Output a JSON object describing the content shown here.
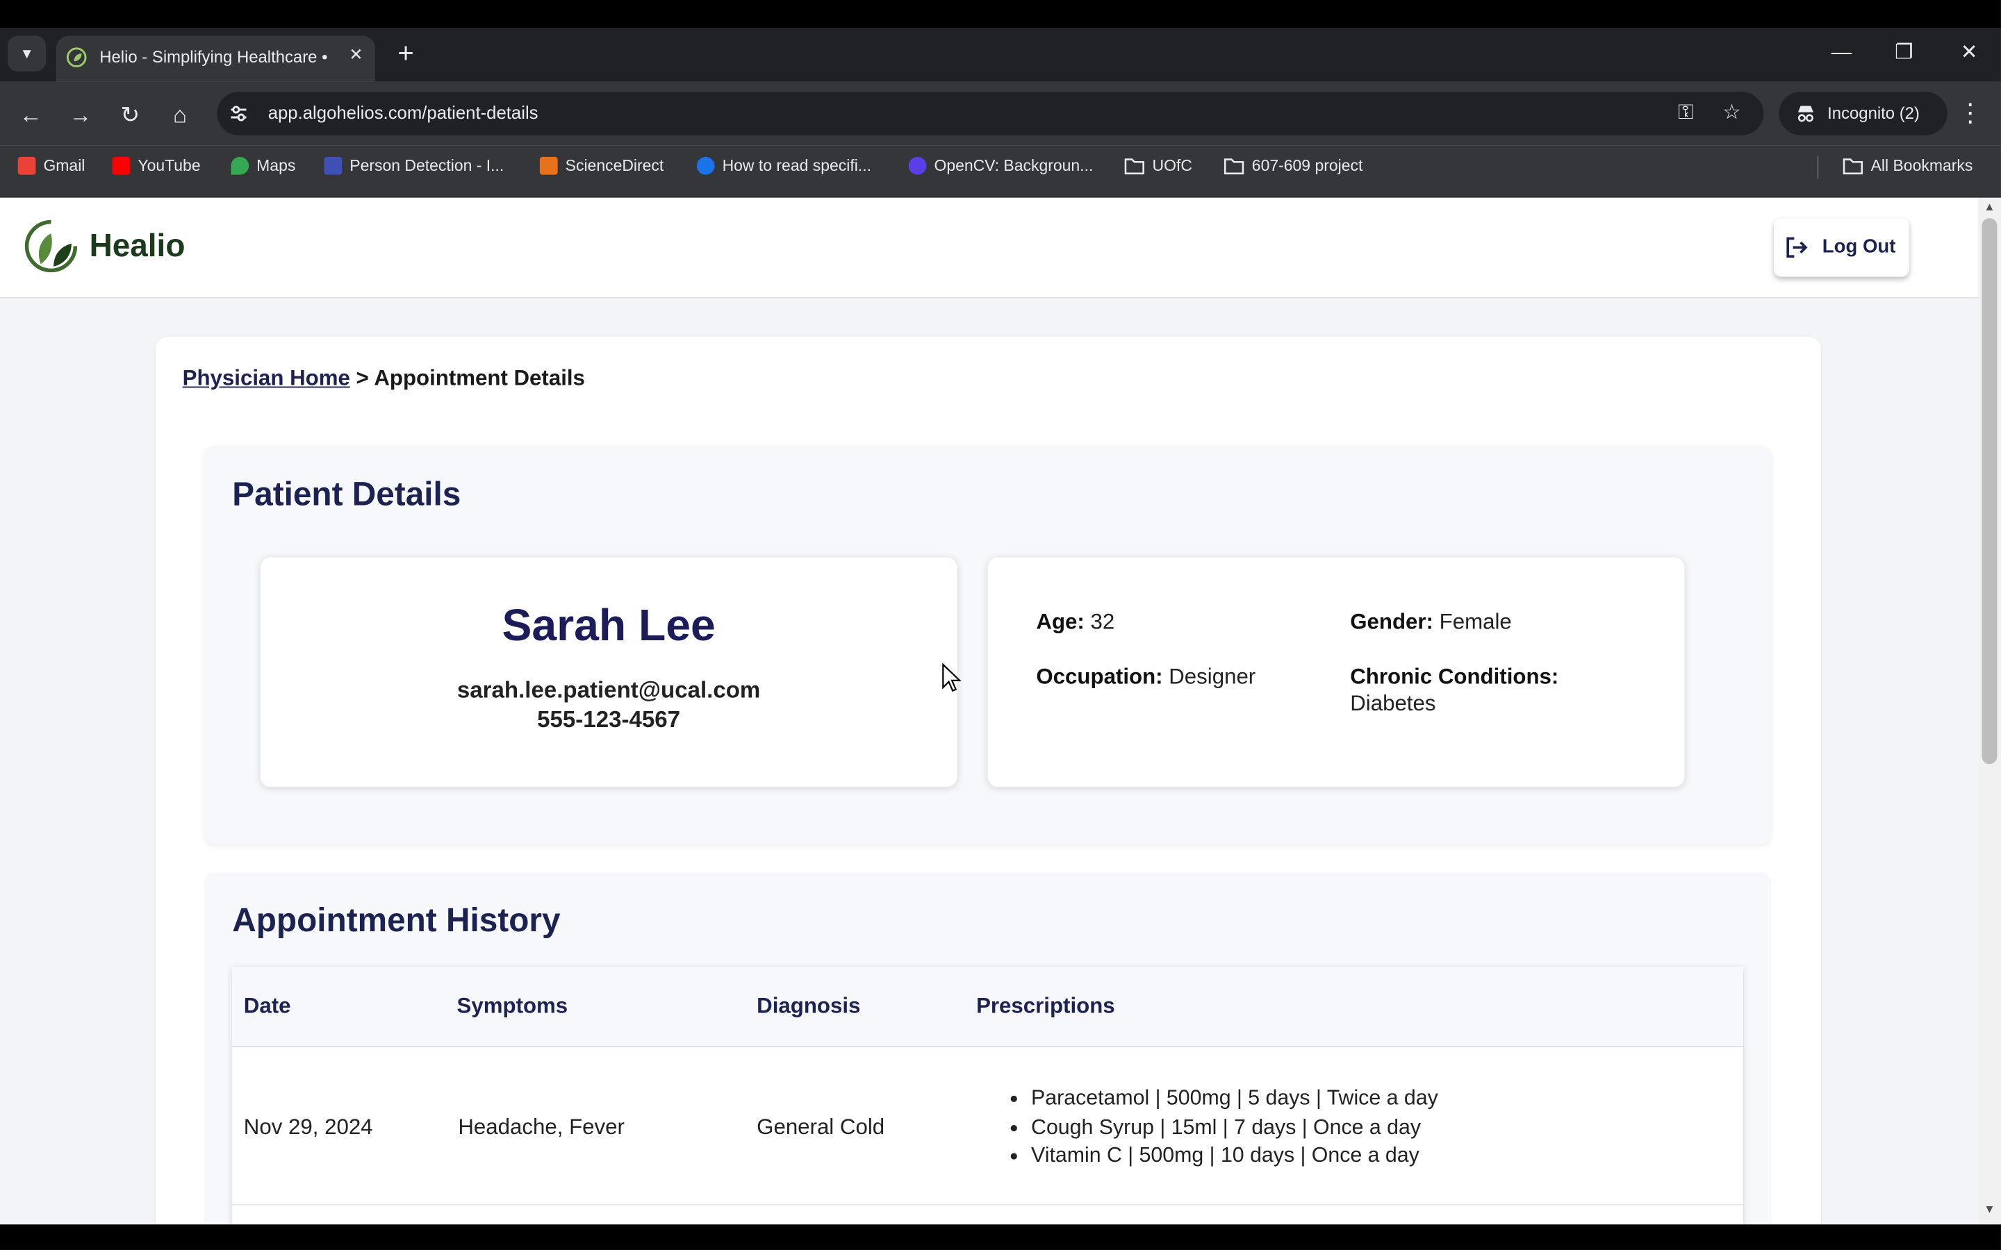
{
  "browser": {
    "tab_title": "Helio - Simplifying Healthcare •",
    "url": "app.algohelios.com/patient-details",
    "incognito_label": "Incognito (2)",
    "bookmarks": [
      {
        "label": "Gmail",
        "icon": "gmail-icon",
        "color": "#ea4335"
      },
      {
        "label": "YouTube",
        "icon": "youtube-icon",
        "color": "#ff0000"
      },
      {
        "label": "Maps",
        "icon": "maps-icon",
        "color": "#34a853"
      },
      {
        "label": "Person Detection - I...",
        "icon": "bookmark-favicon",
        "color": "#3f51b5"
      },
      {
        "label": "ScienceDirect",
        "icon": "sciencedirect-icon",
        "color": "#e9711c"
      },
      {
        "label": "How to read specifi...",
        "icon": "bookmark-favicon",
        "color": "#1a73e8"
      },
      {
        "label": "OpenCV: Backgroun...",
        "icon": "opencv-icon",
        "color": "#5c3ee8"
      },
      {
        "label": "UOfC",
        "icon": "folder-icon",
        "color": "#e8eaed"
      },
      {
        "label": "607-609 project",
        "icon": "folder-icon",
        "color": "#e8eaed"
      }
    ],
    "all_bookmarks_label": "All Bookmarks"
  },
  "header": {
    "brand": "Healio",
    "logout_label": "Log Out"
  },
  "breadcrumb": {
    "home": "Physician Home",
    "separator": ">",
    "current": "Appointment Details"
  },
  "patient_details": {
    "title": "Patient Details",
    "name": "Sarah Lee",
    "email": "sarah.lee.patient@ucal.com",
    "phone": "555-123-4567",
    "age_label": "Age:",
    "age": "32",
    "gender_label": "Gender:",
    "gender": "Female",
    "occupation_label": "Occupation:",
    "occupation": "Designer",
    "chronic_label": "Chronic Conditions:",
    "chronic": "Diabetes"
  },
  "appointment_history": {
    "title": "Appointment History",
    "columns": [
      "Date",
      "Symptoms",
      "Diagnosis",
      "Prescriptions"
    ],
    "rows": [
      {
        "date": "Nov 29, 2024",
        "symptoms": "Headache, Fever",
        "diagnosis": "General Cold",
        "prescriptions": [
          "Paracetamol | 500mg | 5 days | Twice a day",
          "Cough Syrup | 15ml | 7 days | Once a day",
          "Vitamin C | 500mg | 10 days | Once a day"
        ]
      }
    ]
  },
  "colors": {
    "accent": "#1c2352",
    "brand_green": "#1b3a1b",
    "page_bg": "#f3f4f8"
  }
}
